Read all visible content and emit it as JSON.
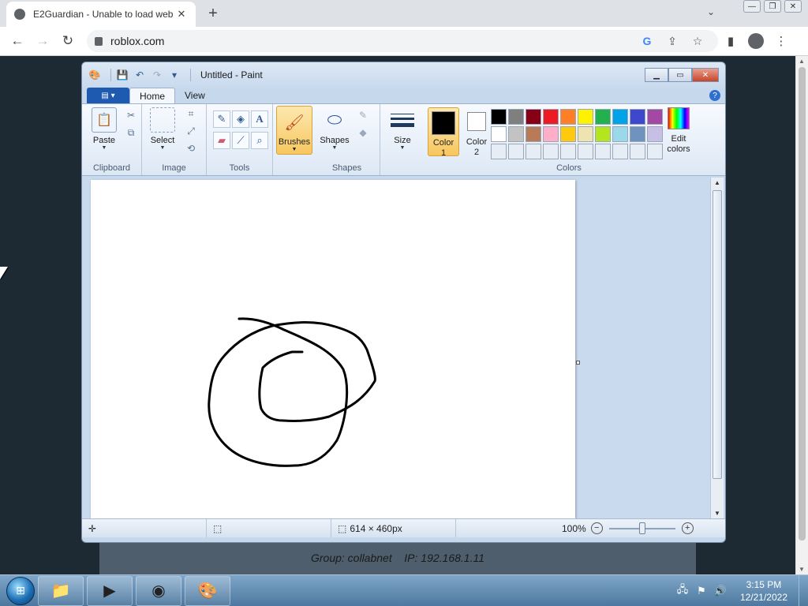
{
  "browser": {
    "tab_title": "E2Guardian - Unable to load web",
    "tab_close": "✕",
    "new_tab": "+",
    "url": "roblox.com",
    "nav": {
      "back": "←",
      "forward": "→",
      "reload": "↻"
    }
  },
  "paint": {
    "window_title": "Untitled - Paint",
    "tabs": {
      "home": "Home",
      "view": "View"
    },
    "groups": {
      "clipboard": "Clipboard",
      "image": "Image",
      "tools": "Tools",
      "shapes": "Shapes",
      "colors": "Colors"
    },
    "buttons": {
      "paste": "Paste",
      "select": "Select",
      "brushes": "Brushes",
      "shapes": "Shapes",
      "size": "Size",
      "color1_line1": "Color",
      "color1_line2": "1",
      "color2_line1": "Color",
      "color2_line2": "2",
      "edit_colors_line1": "Edit",
      "edit_colors_line2": "colors"
    },
    "color1": "#000000",
    "color2": "#ffffff",
    "palette": [
      "#000000",
      "#7f7f7f",
      "#880015",
      "#ed1c24",
      "#ff7f27",
      "#fff200",
      "#22b14c",
      "#00a2e8",
      "#3f48cc",
      "#a349a4",
      "#ffffff",
      "#c3c3c3",
      "#b97a57",
      "#ffaec9",
      "#ffc90e",
      "#efe4b0",
      "#b5e61d",
      "#99d9ea",
      "#7092be",
      "#c8bfe7",
      "#e6edf5",
      "#e6edf5",
      "#e6edf5",
      "#e6edf5",
      "#e6edf5",
      "#e6edf5",
      "#e6edf5",
      "#e6edf5",
      "#e6edf5",
      "#e6edf5"
    ],
    "status": {
      "image_size": "614 × 460px",
      "zoom": "100%"
    }
  },
  "remote_bar": {
    "text": "Group: collabnet    IP: 192.168.1.11"
  },
  "taskbar": {
    "time": "3:15 PM",
    "date": "12/21/2022"
  }
}
